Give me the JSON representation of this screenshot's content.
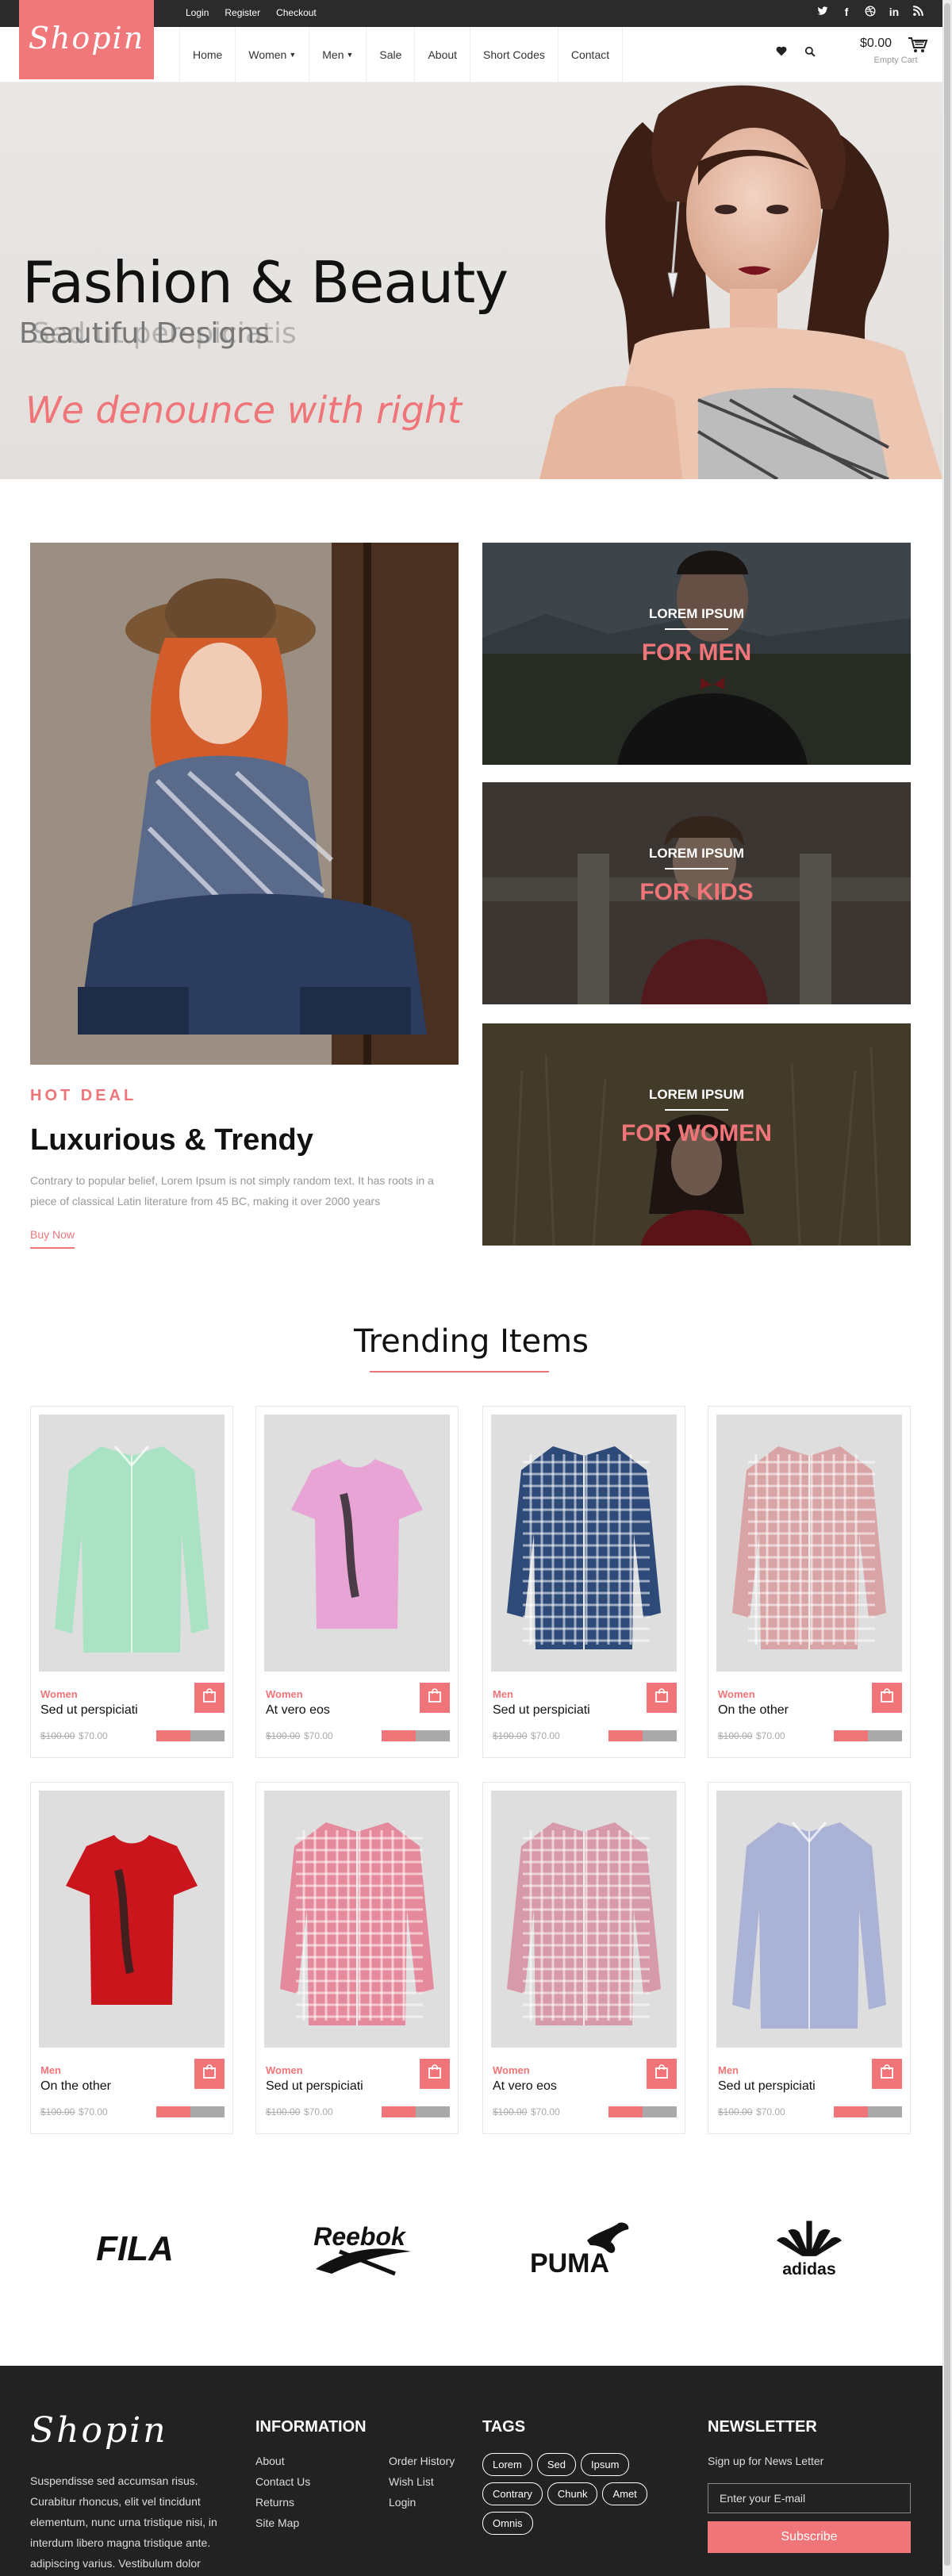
{
  "topbar": {
    "links": [
      "Login",
      "Register",
      "Checkout"
    ],
    "social_icons": [
      "twitter-icon",
      "facebook-icon",
      "dribbble-icon",
      "linkedin-icon",
      "rss-icon"
    ]
  },
  "brand": {
    "logo": "Shopin",
    "accent": "#f07579"
  },
  "nav": {
    "items": [
      {
        "label": "Home"
      },
      {
        "label": "Women"
      },
      {
        "label": "Men"
      },
      {
        "label": "Sale"
      },
      {
        "label": "About"
      },
      {
        "label": "Short Codes"
      },
      {
        "label": "Contact"
      }
    ]
  },
  "cart": {
    "amount": "$0.00",
    "label": "Empty Cart"
  },
  "hero": {
    "title": "Fashion & Beauty",
    "subtitle": "Beautiful Designs",
    "subtitle_ghost": "Sed ut perspiciatis",
    "tagline": "We denounce with right"
  },
  "promo": {
    "hot": "HOT DEAL",
    "title": "Luxurious & Trendy",
    "desc": "Contrary to popular belief, Lorem Ipsum is not simply random text. It has roots in a piece of classical Latin literature from 45 BC, making it over 2000 years",
    "cta": "Buy Now",
    "boxes": [
      {
        "label": "LOREM IPSUM",
        "big": "FOR MEN"
      },
      {
        "label": "LOREM IPSUM",
        "big": "FOR KIDS"
      },
      {
        "label": "LOREM IPSUM",
        "big": "FOR WOMEN"
      }
    ]
  },
  "trending": {
    "title": "Trending Items",
    "products": [
      {
        "cat": "Women",
        "name": "Sed ut perspiciati",
        "old": "$100.00",
        "price": "$70.00",
        "rating": 0.5,
        "color": "#a9e3c4",
        "kind": "shirt"
      },
      {
        "cat": "Women",
        "name": "At vero eos",
        "old": "$100.00",
        "price": "$70.00",
        "rating": 0.5,
        "color": "#e7a4d4",
        "kind": "tee"
      },
      {
        "cat": "Men",
        "name": "Sed ut perspiciati",
        "old": "$100.00",
        "price": "$70.00",
        "rating": 0.5,
        "color": "#2e4a78",
        "kind": "plaid"
      },
      {
        "cat": "Women",
        "name": "On the other",
        "old": "$100.00",
        "price": "$70.00",
        "rating": 0.5,
        "color": "#d9a4a6",
        "kind": "plaid"
      },
      {
        "cat": "Men",
        "name": "On the other",
        "old": "$100.00",
        "price": "$70.00",
        "rating": 0.5,
        "color": "#c9151b",
        "kind": "tee"
      },
      {
        "cat": "Women",
        "name": "Sed ut perspiciati",
        "old": "$100.00",
        "price": "$70.00",
        "rating": 0.5,
        "color": "#e58a9c",
        "kind": "plaid"
      },
      {
        "cat": "Women",
        "name": "At vero eos",
        "old": "$100.00",
        "price": "$70.00",
        "rating": 0.5,
        "color": "#d69aaa",
        "kind": "plaid"
      },
      {
        "cat": "Men",
        "name": "Sed ut perspiciati",
        "old": "$100.00",
        "price": "$70.00",
        "rating": 0.5,
        "color": "#aab2d6",
        "kind": "shirt"
      }
    ]
  },
  "brands": [
    "FILA",
    "Reebok",
    "PUMA",
    "adidas"
  ],
  "footer": {
    "logo": "Shopin",
    "text": "Suspendisse sed accumsan risus. Curabitur rhoncus, elit vel tincidunt elementum, nunc urna tristique nisi, in interdum libero magna tristique ante. adipiscing varius. Vestibulum dolor",
    "info_title": "INFORMATION",
    "info_col1": [
      "About",
      "Contact Us",
      "Returns",
      "Site Map"
    ],
    "info_col2": [
      "Order History",
      "Wish List",
      "Login"
    ],
    "tags_title": "TAGS",
    "tags": [
      "Lorem",
      "Sed",
      "Ipsum",
      "Contrary",
      "Chunk",
      "Amet",
      "Omnis"
    ],
    "news_title": "NEWSLETTER",
    "news_text": "Sign up for News Letter",
    "news_placeholder": "Enter your E-mail",
    "news_button": "Subscribe"
  }
}
